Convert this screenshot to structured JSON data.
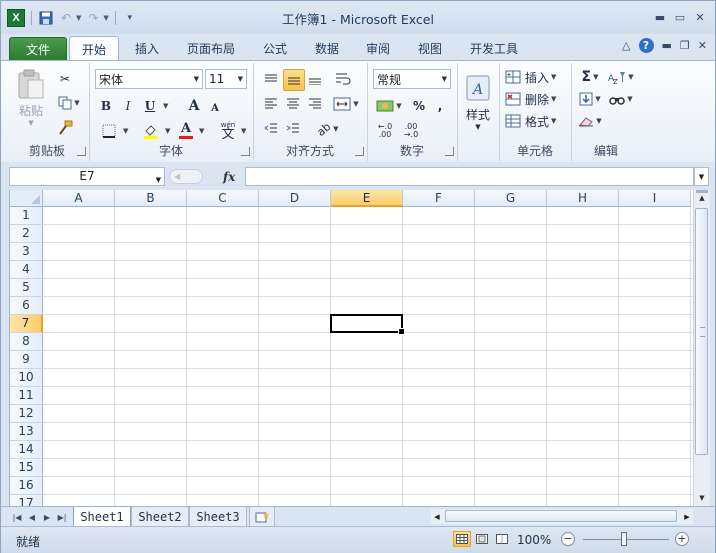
{
  "window": {
    "title": "工作簿1 - Microsoft Excel"
  },
  "qat": {
    "logo_letter": "X"
  },
  "tabs": {
    "file": "文件",
    "home": "开始",
    "insert": "插入",
    "page_layout": "页面布局",
    "formulas": "公式",
    "data": "数据",
    "review": "审阅",
    "view": "视图",
    "developer": "开发工具"
  },
  "ribbon": {
    "clipboard": {
      "label": "剪贴板",
      "paste": "粘贴"
    },
    "font": {
      "label": "字体",
      "name": "宋体",
      "size": "11",
      "bold": "B",
      "italic": "I",
      "underline": "U",
      "grow": "A",
      "shrink": "A",
      "font_color": "A",
      "wen": "wén",
      "wen_char": "文"
    },
    "alignment": {
      "label": "对齐方式"
    },
    "number": {
      "label": "数字",
      "format": "常规",
      "percent": "%",
      "comma": ","
    },
    "styles": {
      "label": "样式"
    },
    "cells": {
      "label": "单元格",
      "insert": "插入",
      "delete": "删除",
      "format": "格式"
    },
    "editing": {
      "label": "编辑",
      "sum": "Σ"
    }
  },
  "formula_bar": {
    "name_box": "E7",
    "fx": "fx",
    "value": ""
  },
  "grid": {
    "columns": [
      "A",
      "B",
      "C",
      "D",
      "E",
      "F",
      "G",
      "H",
      "I"
    ],
    "rows": [
      "1",
      "2",
      "3",
      "4",
      "5",
      "6",
      "7",
      "8",
      "9",
      "10",
      "11",
      "12",
      "13",
      "14",
      "15",
      "16",
      "17"
    ],
    "active_column": "E",
    "active_row": "7"
  },
  "sheets": [
    "Sheet1",
    "Sheet2",
    "Sheet3"
  ],
  "status": {
    "ready": "就绪",
    "zoom": "100%"
  },
  "colors": {
    "file_tab": "#2c7a31",
    "selection_header": "#f9cd6a",
    "active_border": "#000000"
  }
}
